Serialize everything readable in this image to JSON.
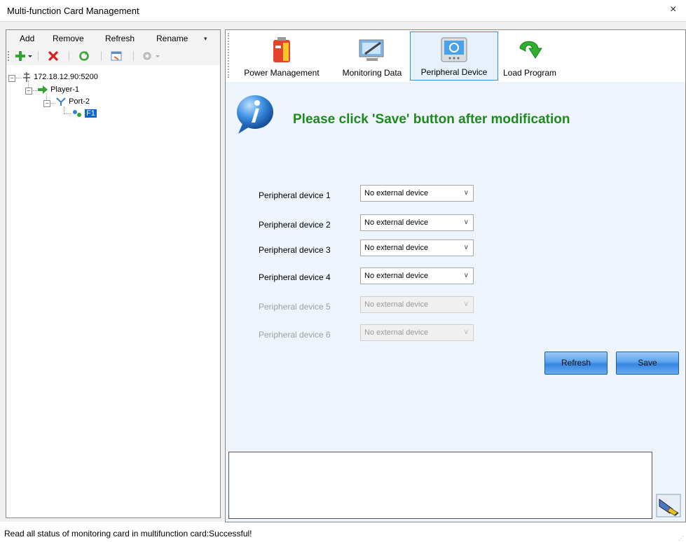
{
  "window": {
    "title": "Multi-function Card Management",
    "close_glyph": "×"
  },
  "left_panel": {
    "menu": [
      {
        "label": "Add"
      },
      {
        "label": "Remove"
      },
      {
        "label": "Refresh"
      },
      {
        "label": "Rename"
      }
    ],
    "toolbar_icons": [
      "add-icon",
      "delete-icon",
      "refresh-icon",
      "screen-icon",
      "settings-icon"
    ],
    "tree": {
      "root": "172.18.12.90:5200",
      "player": "Player-1",
      "port": "Port-2",
      "card": "F1"
    }
  },
  "tabs": [
    {
      "label": "Power Management",
      "icon": "battery-icon"
    },
    {
      "label": "Monitoring Data",
      "icon": "monitor-icon"
    },
    {
      "label": "Peripheral Device",
      "icon": "peripheral-icon",
      "active": true
    },
    {
      "label": "Load Program",
      "icon": "load-arrow-icon"
    }
  ],
  "notice": "Please click 'Save' button after modification",
  "devices": [
    {
      "label": "Peripheral device 1",
      "value": "No external device",
      "enabled": true
    },
    {
      "label": "Peripheral device 2",
      "value": "No external device",
      "enabled": true
    },
    {
      "label": "Peripheral device 3",
      "value": "No external device",
      "enabled": true
    },
    {
      "label": "Peripheral device 4",
      "value": "No external device",
      "enabled": true
    },
    {
      "label": "Peripheral device 5",
      "value": "No external device",
      "enabled": false
    },
    {
      "label": "Peripheral device 6",
      "value": "No external device",
      "enabled": false
    }
  ],
  "buttons": {
    "refresh": "Refresh",
    "save": "Save"
  },
  "status": "Read all status of monitoring card in multifunction card:Successful!",
  "colors": {
    "notice": "#1e8a1e",
    "selection": "#0a64d2",
    "button": "#3585e0"
  }
}
